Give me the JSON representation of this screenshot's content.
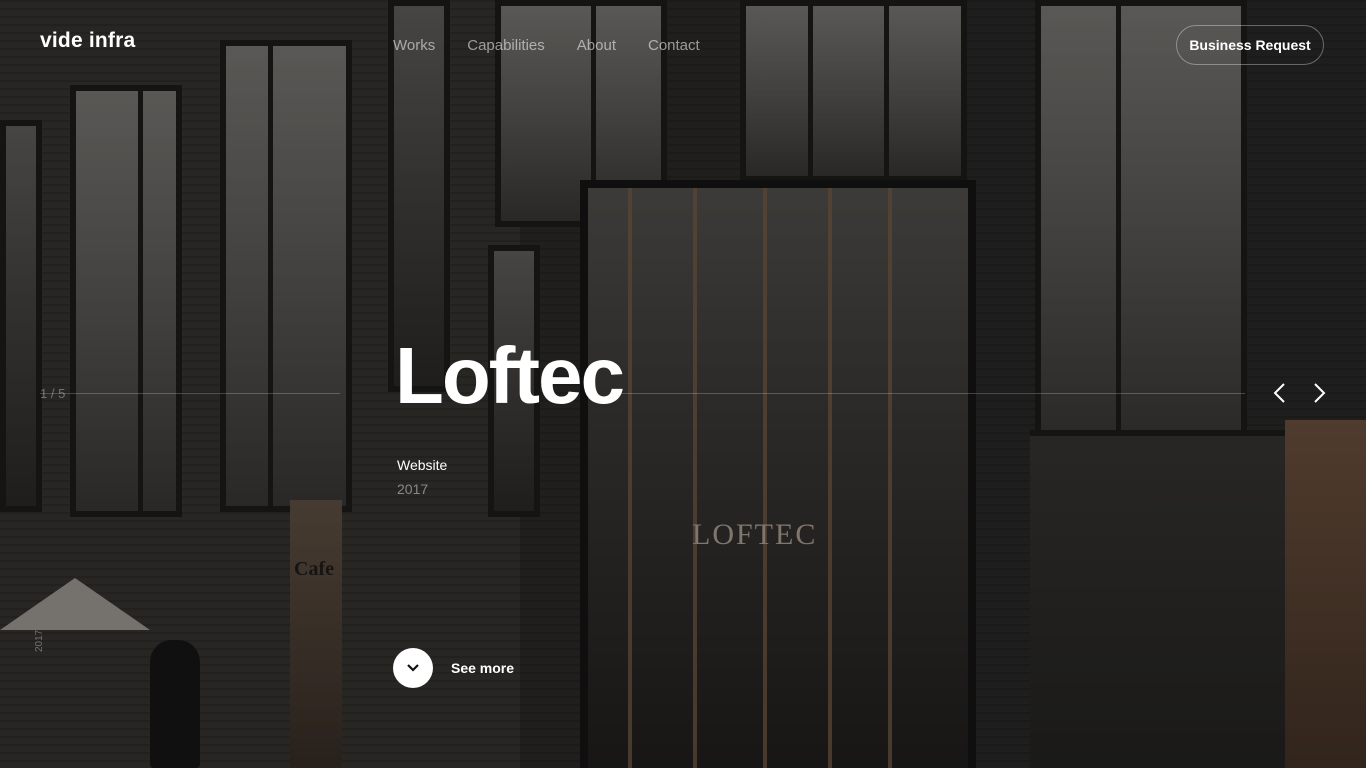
{
  "header": {
    "logo": "vide infra",
    "nav": [
      "Works",
      "Capabilities",
      "About",
      "Contact"
    ],
    "cta": "Business Request"
  },
  "hero": {
    "counter": "1 / 5",
    "title": "Loftec",
    "category": "Website",
    "year": "2017",
    "see_more": "See more",
    "sign_text": "LOFTEC",
    "cafe_text": "Cafe",
    "vertical_year": "2017"
  },
  "icons": {
    "prev": "chevron-left-icon",
    "next": "chevron-right-icon",
    "see_more": "chevron-down-icon"
  },
  "colors": {
    "text": "#ffffff",
    "muted": "#8c8c8c",
    "cta_border": "#5a5a5a"
  }
}
